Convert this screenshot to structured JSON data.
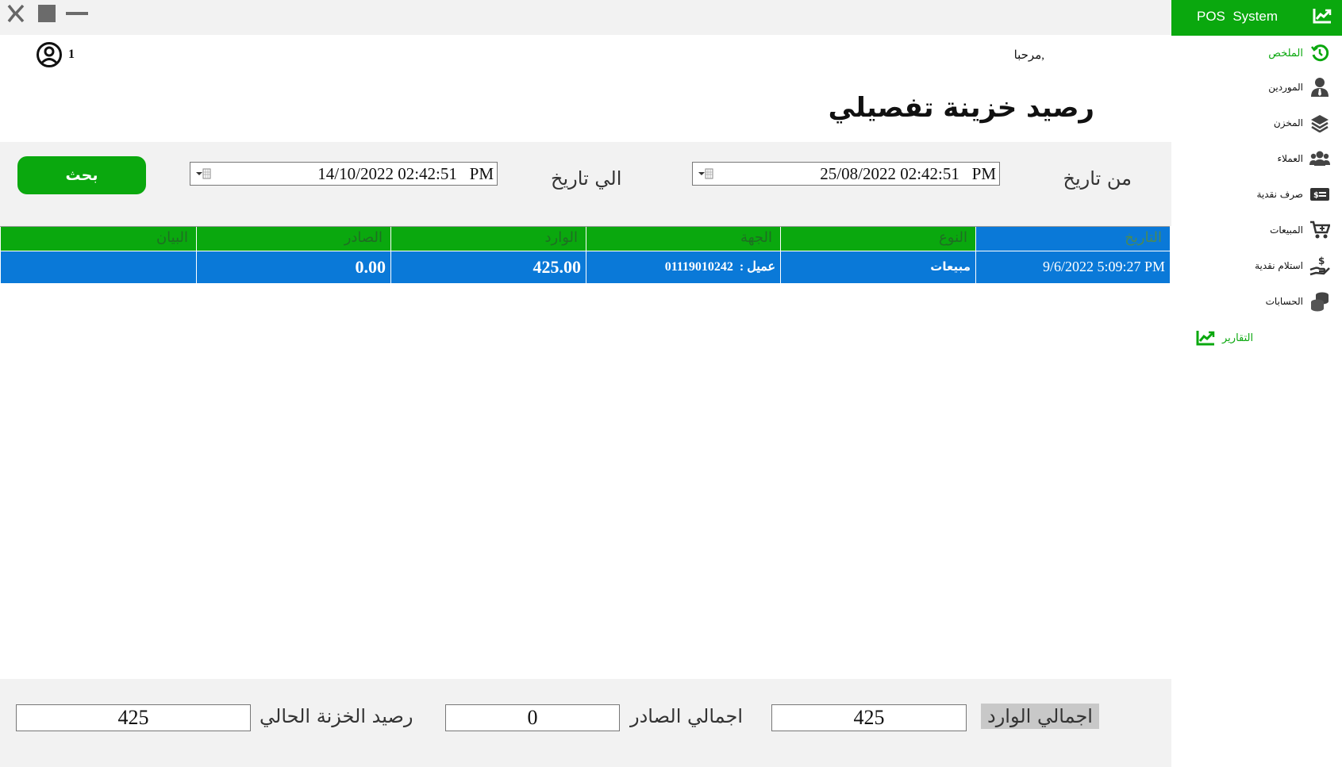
{
  "window": {
    "close_icon": "close-icon",
    "maximize_icon": "maximize-icon",
    "minimize_icon": "minimize-icon"
  },
  "sidebar": {
    "brand": "POS  System",
    "brand_icon": "chart-line-icon",
    "items": [
      {
        "label": "الملخص",
        "icon": "history-icon",
        "active": true
      },
      {
        "label": "الموردين",
        "icon": "user-tie-icon",
        "active": false
      },
      {
        "label": "المخزن",
        "icon": "layers-icon",
        "active": false
      },
      {
        "label": "العملاء",
        "icon": "users-icon",
        "active": false
      },
      {
        "label": "صرف نقدية",
        "icon": "money-bill-icon",
        "active": false
      },
      {
        "label": "المبيعات",
        "icon": "cart-icon",
        "active": false
      },
      {
        "label": "استلام نقدية",
        "icon": "hand-holding-dollar-icon",
        "active": false
      },
      {
        "label": "الحسابات",
        "icon": "coins-icon",
        "active": false
      },
      {
        "label": "التقارير",
        "icon": "chart-line-icon",
        "active": true
      }
    ]
  },
  "header": {
    "welcome": "مرحبا,",
    "user_number": "1"
  },
  "page": {
    "title": "رصيد خزينة تفصيلي"
  },
  "filter": {
    "from_label": "من تاريخ",
    "from_value": "25/08/2022 02:42:51   PM",
    "to_label": "الي تاريخ",
    "to_value": "14/10/2022 02:42:51   PM",
    "search_label": "بحث"
  },
  "table": {
    "columns": [
      "التاريخ",
      "النوع",
      "الجهة",
      "الوارد",
      "الصادر",
      "البيان"
    ],
    "rows": [
      {
        "date": "9/6/2022 5:09:27 PM",
        "type": "مبيعات",
        "party": "عميل :  01119010242",
        "in": "425.00",
        "out": "0.00",
        "note": ""
      }
    ]
  },
  "totals": {
    "in_label": "اجمالي الوارد",
    "in_value": "425",
    "out_label": "اجمالي الصادر",
    "out_value": "0",
    "balance_label": "رصيد الخزنة الحالي",
    "balance_value": "425"
  },
  "colors": {
    "accent_green": "#0aa80e",
    "selection_blue": "#0a79d8"
  }
}
